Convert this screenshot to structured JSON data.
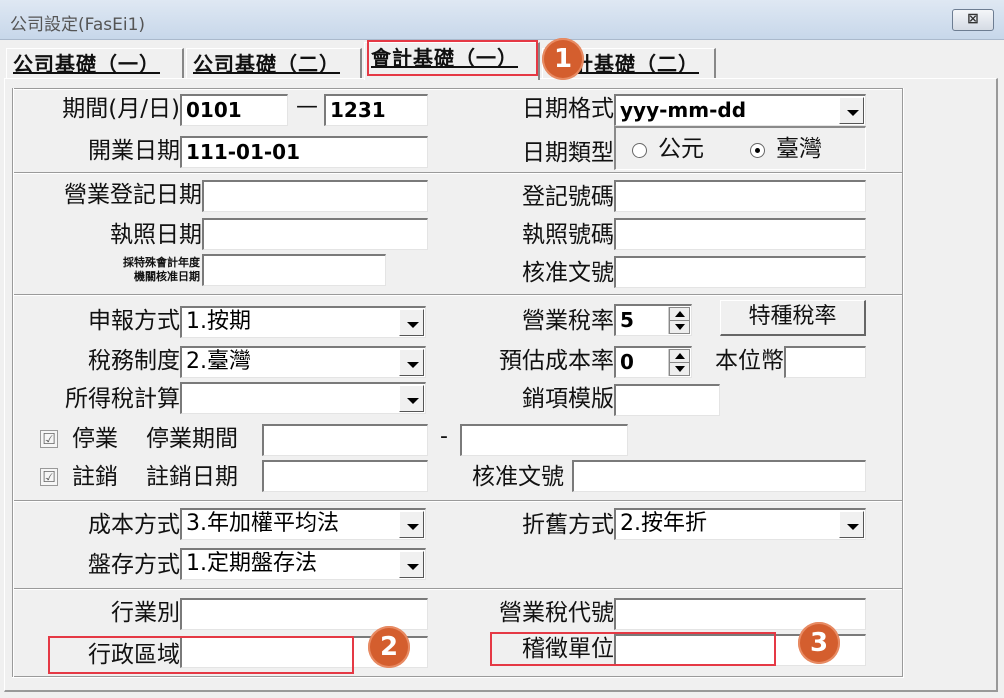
{
  "window": {
    "title": "公司設定(FasEi1)",
    "close_glyph": "⊠"
  },
  "tabs": [
    {
      "label": "公司基礎（一）"
    },
    {
      "label": "公司基礎（二）"
    },
    {
      "label": "會計基礎（一）"
    },
    {
      "label": "計基礎（二）"
    }
  ],
  "callouts": {
    "c1": "1",
    "c2": "2",
    "c3": "3"
  },
  "section1": {
    "period_label": "期間(月/日)",
    "period_from": "0101",
    "period_dash": "—",
    "period_to": "1231",
    "open_date_label": "開業日期",
    "open_date": "111-01-01",
    "date_format_label": "日期格式",
    "date_format": "yyy-mm-dd",
    "date_type_label": "日期類型",
    "date_type_options": [
      "公元",
      "臺灣"
    ],
    "date_type_selected": "臺灣"
  },
  "section2": {
    "reg_date_label": "營業登記日期",
    "reg_date": "",
    "reg_no_label": "登記號碼",
    "reg_no": "",
    "license_date_label": "執照日期",
    "license_date": "",
    "license_no_label": "執照號碼",
    "license_no": "",
    "special_year_label_1": "採特殊會計年度",
    "special_year_label_2": "機關核准日期",
    "special_year_date": "",
    "approval_no_label": "核准文號",
    "approval_no": ""
  },
  "section3": {
    "filing_method_label": "申報方式",
    "filing_method": "1.按期",
    "tax_system_label": "稅務制度",
    "tax_system": "2.臺灣",
    "income_tax_label": "所得稅計算",
    "income_tax": "",
    "business_tax_label": "營業稅率",
    "business_tax": "5",
    "special_tax_button": "特種稅率",
    "est_cost_label": "預估成本率",
    "est_cost": "0",
    "base_currency_label": "本位幣",
    "base_currency": "",
    "sales_template_label": "銷項模版",
    "sales_template": "",
    "suspend_label": "停業",
    "suspend_period_label": "停業期間",
    "suspend_from": "",
    "suspend_dash": "-",
    "suspend_to": "",
    "cancel_label": "註銷",
    "cancel_date_label": "註銷日期",
    "cancel_date": "",
    "cancel_approval_label": "核准文號",
    "cancel_approval": "",
    "check_glyph": "☑"
  },
  "section4": {
    "cost_method_label": "成本方式",
    "cost_method": "3.年加權平均法",
    "depreciation_label": "折舊方式",
    "depreciation": "2.按年折",
    "inventory_label": "盤存方式",
    "inventory": "1.定期盤存法"
  },
  "section5": {
    "industry_label": "行業別",
    "industry": "",
    "business_tax_code_label": "營業稅代號",
    "business_tax_code": "",
    "district_label": "行政區域",
    "district": "",
    "tax_office_label": "稽徵單位",
    "tax_office": ""
  },
  "colors": {
    "highlight": "#e53945",
    "callout": "#d45e2e"
  }
}
